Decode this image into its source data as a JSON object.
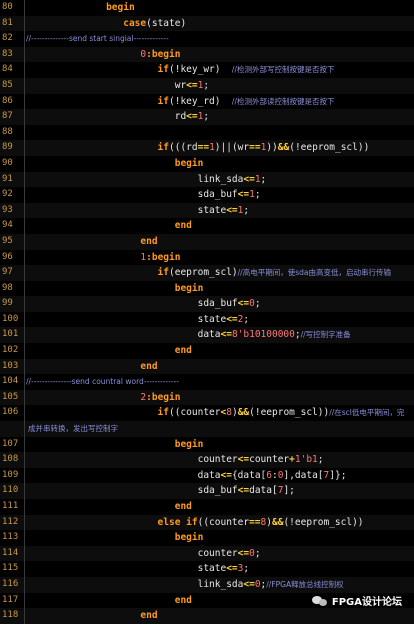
{
  "watermark": {
    "text": "FPGA设计论坛",
    "icon": "wechat-icon"
  },
  "lines": [
    {
      "n": "80",
      "indent": 14,
      "seg": [
        [
          "kw",
          "begin"
        ]
      ]
    },
    {
      "n": "81",
      "indent": 17,
      "seg": [
        [
          "kw",
          "case"
        ],
        [
          "id",
          "(state)"
        ]
      ]
    },
    {
      "n": "82",
      "indent": 0,
      "seg": [
        [
          "cm",
          "//--------------send start singial-------------"
        ]
      ]
    },
    {
      "n": "83",
      "indent": 20,
      "seg": [
        [
          "num",
          "0"
        ],
        [
          "kw",
          ":begin"
        ]
      ]
    },
    {
      "n": "84",
      "indent": 23,
      "seg": [
        [
          "kw",
          "if"
        ],
        [
          "id",
          "(!key_wr)  "
        ],
        [
          "cm",
          "//检测外部写控制按键是否按下"
        ]
      ]
    },
    {
      "n": "85",
      "indent": 26,
      "seg": [
        [
          "id",
          "wr"
        ],
        [
          "op",
          "<="
        ],
        [
          "num",
          "1"
        ],
        [
          "id",
          ";"
        ]
      ]
    },
    {
      "n": "86",
      "indent": 23,
      "seg": [
        [
          "kw",
          "if"
        ],
        [
          "id",
          "(!key_rd)  "
        ],
        [
          "cm",
          "//检测外部读控制按键是否按下"
        ]
      ]
    },
    {
      "n": "87",
      "indent": 26,
      "seg": [
        [
          "id",
          "rd"
        ],
        [
          "op",
          "<="
        ],
        [
          "num",
          "1"
        ],
        [
          "id",
          ";"
        ]
      ]
    },
    {
      "n": "88",
      "indent": 0,
      "seg": []
    },
    {
      "n": "89",
      "indent": 23,
      "seg": [
        [
          "kw",
          "if"
        ],
        [
          "id",
          "(((rd"
        ],
        [
          "op",
          "=="
        ],
        [
          "num",
          "1"
        ],
        [
          "id",
          ")||(wr"
        ],
        [
          "op",
          "=="
        ],
        [
          "num",
          "1"
        ],
        [
          "id",
          "))"
        ],
        [
          "op",
          "&&"
        ],
        [
          "id",
          "(!eeprom_scl))"
        ]
      ]
    },
    {
      "n": "90",
      "indent": 26,
      "seg": [
        [
          "kw",
          "begin"
        ]
      ]
    },
    {
      "n": "91",
      "indent": 30,
      "seg": [
        [
          "id",
          "link_sda"
        ],
        [
          "op",
          "<="
        ],
        [
          "num",
          "1"
        ],
        [
          "id",
          ";"
        ]
      ]
    },
    {
      "n": "92",
      "indent": 30,
      "seg": [
        [
          "id",
          "sda_buf"
        ],
        [
          "op",
          "<="
        ],
        [
          "num",
          "1"
        ],
        [
          "id",
          ";"
        ]
      ]
    },
    {
      "n": "93",
      "indent": 30,
      "seg": [
        [
          "id",
          "state"
        ],
        [
          "op",
          "<="
        ],
        [
          "num",
          "1"
        ],
        [
          "id",
          ";"
        ]
      ]
    },
    {
      "n": "94",
      "indent": 26,
      "seg": [
        [
          "kw",
          "end"
        ]
      ]
    },
    {
      "n": "95",
      "indent": 20,
      "seg": [
        [
          "kw",
          "end"
        ]
      ]
    },
    {
      "n": "96",
      "indent": 20,
      "seg": [
        [
          "num",
          "1"
        ],
        [
          "kw",
          ":begin"
        ]
      ]
    },
    {
      "n": "97",
      "indent": 23,
      "seg": [
        [
          "kw",
          "if"
        ],
        [
          "id",
          "(eeprom_scl)"
        ],
        [
          "cm",
          "//高电平期间，使sda由高变低，启动串行传输"
        ]
      ]
    },
    {
      "n": "98",
      "indent": 26,
      "seg": [
        [
          "kw",
          "begin"
        ]
      ]
    },
    {
      "n": "99",
      "indent": 30,
      "seg": [
        [
          "id",
          "sda_buf"
        ],
        [
          "op",
          "<="
        ],
        [
          "num",
          "0"
        ],
        [
          "id",
          ";"
        ]
      ]
    },
    {
      "n": "100",
      "indent": 30,
      "seg": [
        [
          "id",
          "state"
        ],
        [
          "op",
          "<="
        ],
        [
          "num",
          "2"
        ],
        [
          "id",
          ";"
        ]
      ]
    },
    {
      "n": "101",
      "indent": 30,
      "seg": [
        [
          "id",
          "data"
        ],
        [
          "op",
          "<="
        ],
        [
          "num",
          "8'b10100000"
        ],
        [
          "id",
          ";"
        ],
        [
          "cm",
          "//写控制字准备"
        ]
      ]
    },
    {
      "n": "102",
      "indent": 26,
      "seg": [
        [
          "kw",
          "end"
        ]
      ]
    },
    {
      "n": "103",
      "indent": 20,
      "seg": [
        [
          "kw",
          "end"
        ]
      ]
    },
    {
      "n": "104",
      "indent": 0,
      "seg": [
        [
          "cm",
          "//---------------send countral word-------------"
        ]
      ]
    },
    {
      "n": "105",
      "indent": 20,
      "seg": [
        [
          "num",
          "2"
        ],
        [
          "kw",
          ":begin"
        ]
      ]
    },
    {
      "n": "106",
      "indent": 23,
      "seg": [
        [
          "kw",
          "if"
        ],
        [
          "id",
          "((counter"
        ],
        [
          "op",
          "<"
        ],
        [
          "num",
          "8"
        ],
        [
          "id",
          ")"
        ],
        [
          "op",
          "&&"
        ],
        [
          "id",
          "(!eeprom_scl))"
        ],
        [
          "cm",
          "//在scl低电平期间，完"
        ]
      ]
    },
    {
      "n": "",
      "indent": 0,
      "seg": [
        [
          "wrap",
          "成并串转换，发出写控制字"
        ]
      ]
    },
    {
      "n": "107",
      "indent": 26,
      "seg": [
        [
          "kw",
          "begin"
        ]
      ]
    },
    {
      "n": "108",
      "indent": 30,
      "seg": [
        [
          "id",
          "counter"
        ],
        [
          "op",
          "<="
        ],
        [
          "id",
          "counter"
        ],
        [
          "op",
          "+"
        ],
        [
          "num",
          "1'b1"
        ],
        [
          "id",
          ";"
        ]
      ]
    },
    {
      "n": "109",
      "indent": 30,
      "seg": [
        [
          "id",
          "data"
        ],
        [
          "op",
          "<="
        ],
        [
          "id",
          "{data["
        ],
        [
          "num",
          "6"
        ],
        [
          "id",
          ":"
        ],
        [
          "num",
          "0"
        ],
        [
          "id",
          "],data["
        ],
        [
          "num",
          "7"
        ],
        [
          "id",
          "]};"
        ]
      ]
    },
    {
      "n": "110",
      "indent": 30,
      "seg": [
        [
          "id",
          "sda_buf"
        ],
        [
          "op",
          "<="
        ],
        [
          "id",
          "data["
        ],
        [
          "num",
          "7"
        ],
        [
          "id",
          "];"
        ]
      ]
    },
    {
      "n": "111",
      "indent": 26,
      "seg": [
        [
          "kw",
          "end"
        ]
      ]
    },
    {
      "n": "112",
      "indent": 23,
      "seg": [
        [
          "kw",
          "else if"
        ],
        [
          "id",
          "((counter"
        ],
        [
          "op",
          "=="
        ],
        [
          "num",
          "8"
        ],
        [
          "id",
          ")"
        ],
        [
          "op",
          "&&"
        ],
        [
          "id",
          "(!eeprom_scl))"
        ]
      ]
    },
    {
      "n": "113",
      "indent": 26,
      "seg": [
        [
          "kw",
          "begin"
        ]
      ]
    },
    {
      "n": "114",
      "indent": 30,
      "seg": [
        [
          "id",
          "counter"
        ],
        [
          "op",
          "<="
        ],
        [
          "num",
          "0"
        ],
        [
          "id",
          ";"
        ]
      ]
    },
    {
      "n": "115",
      "indent": 30,
      "seg": [
        [
          "id",
          "state"
        ],
        [
          "op",
          "<="
        ],
        [
          "num",
          "3"
        ],
        [
          "id",
          ";"
        ]
      ]
    },
    {
      "n": "116",
      "indent": 30,
      "seg": [
        [
          "id",
          "link_sda"
        ],
        [
          "op",
          "<="
        ],
        [
          "num",
          "0"
        ],
        [
          "id",
          ";"
        ],
        [
          "cm",
          "//FPGA释放总线控制权"
        ]
      ]
    },
    {
      "n": "117",
      "indent": 26,
      "seg": [
        [
          "kw",
          "end"
        ]
      ]
    },
    {
      "n": "118",
      "indent": 20,
      "seg": [
        [
          "kw",
          "end"
        ]
      ]
    }
  ]
}
